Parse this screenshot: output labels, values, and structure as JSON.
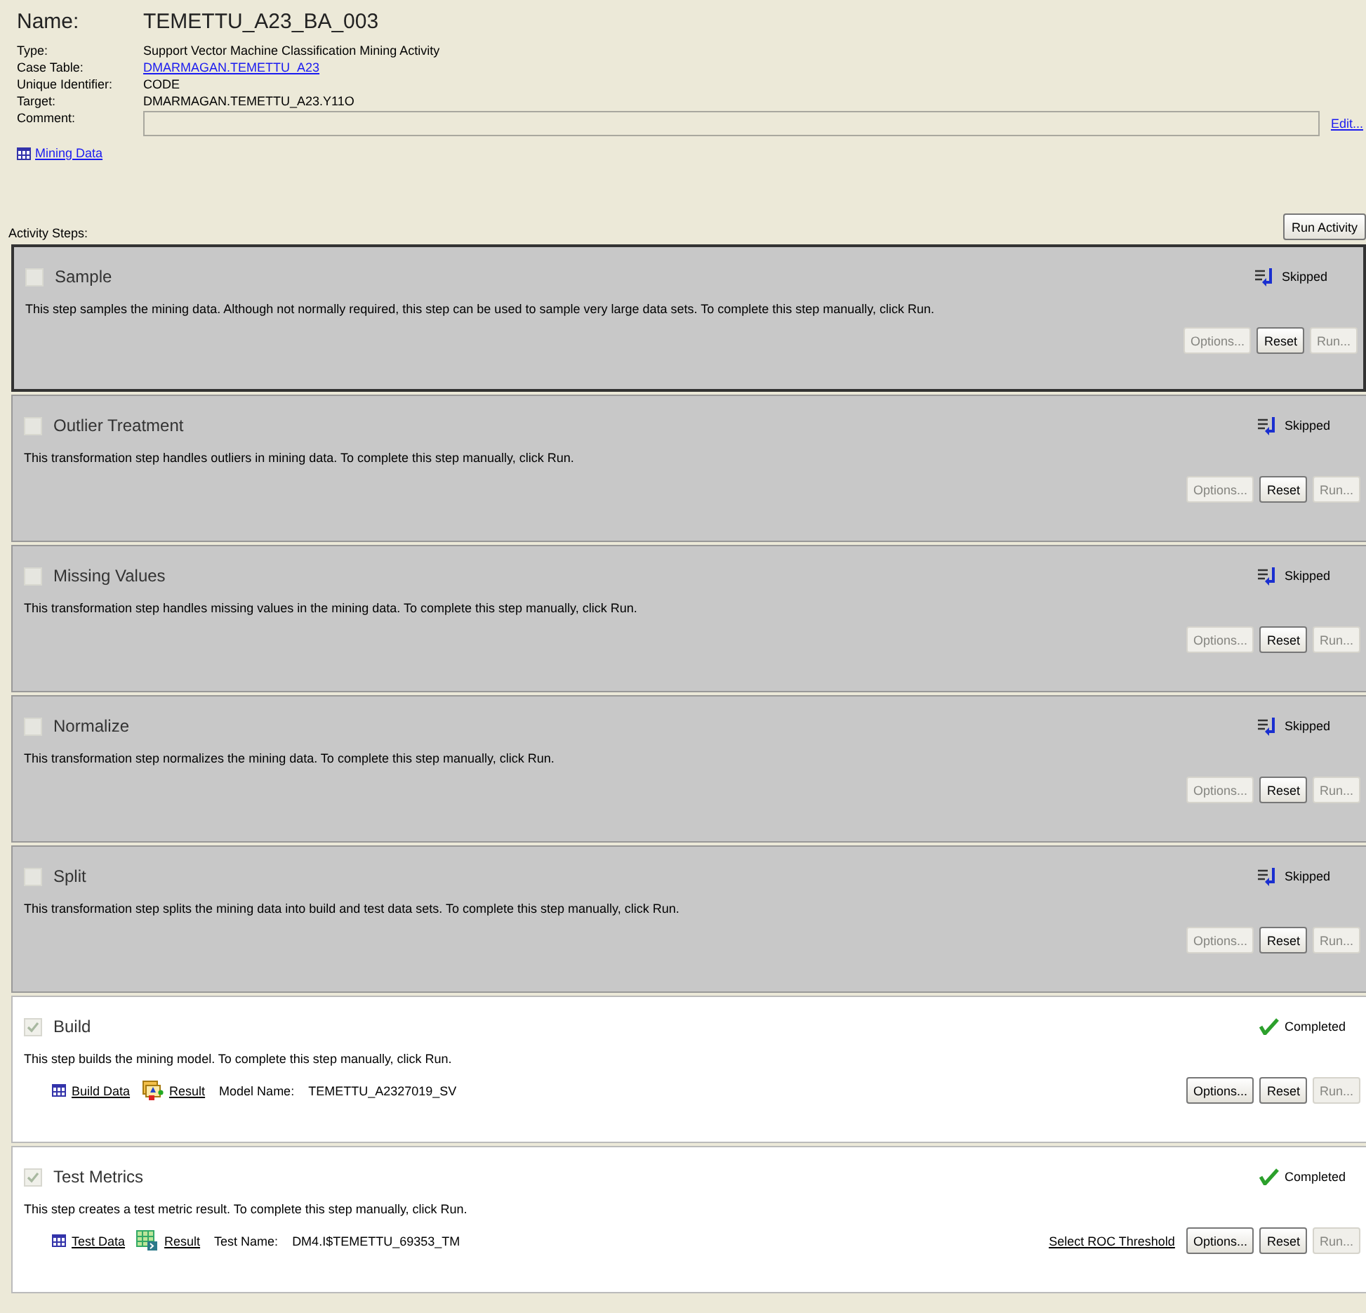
{
  "header": {
    "name_label": "Name:",
    "name": "TEMETTU_A23_BA_003",
    "fields": [
      {
        "label": "Type:",
        "value": "Support Vector Machine Classification Mining Activity",
        "kind": "text"
      },
      {
        "label": "Case Table:",
        "value": "DMARMAGAN.TEMETTU_A23",
        "kind": "link"
      },
      {
        "label": "Unique Identifier:",
        "value": "CODE",
        "kind": "text"
      },
      {
        "label": "Target:",
        "value": "DMARMAGAN.TEMETTU_A23.Y11O",
        "kind": "text"
      }
    ],
    "comment_label": "Comment:",
    "edit_link": "Edit...",
    "mining_data_link": "Mining Data"
  },
  "activity_steps_label": "Activity Steps:",
  "run_activity_button": "Run Activity",
  "steps": [
    {
      "title": "Sample",
      "selected": true,
      "checked": false,
      "status": {
        "kind": "skipped",
        "label": "Skipped"
      },
      "description": "This step samples the mining data. Although not normally required, this step can be used to sample very large data sets. To complete this step manually, click Run.",
      "buttons": [
        {
          "label": "Options...",
          "disabled": true
        },
        {
          "label": "Reset",
          "disabled": false
        },
        {
          "label": "Run...",
          "disabled": true
        }
      ]
    },
    {
      "title": "Outlier Treatment",
      "selected": false,
      "checked": false,
      "status": {
        "kind": "skipped",
        "label": "Skipped"
      },
      "description": "This transformation step handles outliers in mining data. To complete this step manually, click Run.",
      "buttons": [
        {
          "label": "Options...",
          "disabled": true
        },
        {
          "label": "Reset",
          "disabled": false
        },
        {
          "label": "Run...",
          "disabled": true
        }
      ]
    },
    {
      "title": "Missing Values",
      "selected": false,
      "checked": false,
      "status": {
        "kind": "skipped",
        "label": "Skipped"
      },
      "description": "This transformation step handles missing values in the mining data. To complete this step manually, click Run.",
      "buttons": [
        {
          "label": "Options...",
          "disabled": true
        },
        {
          "label": "Reset",
          "disabled": false
        },
        {
          "label": "Run...",
          "disabled": true
        }
      ]
    },
    {
      "title": "Normalize",
      "selected": false,
      "checked": false,
      "status": {
        "kind": "skipped",
        "label": "Skipped"
      },
      "description": "This transformation step normalizes the mining data. To complete this step manually, click Run.",
      "buttons": [
        {
          "label": "Options...",
          "disabled": true
        },
        {
          "label": "Reset",
          "disabled": false
        },
        {
          "label": "Run...",
          "disabled": true
        }
      ]
    },
    {
      "title": "Split",
      "selected": false,
      "checked": false,
      "status": {
        "kind": "skipped",
        "label": "Skipped"
      },
      "description": "This transformation step splits the mining data into build and test data sets. To complete this step manually, click Run.",
      "buttons": [
        {
          "label": "Options...",
          "disabled": true
        },
        {
          "label": "Reset",
          "disabled": false
        },
        {
          "label": "Run...",
          "disabled": true
        }
      ]
    },
    {
      "title": "Build",
      "selected": false,
      "checked": true,
      "status": {
        "kind": "completed",
        "label": "Completed"
      },
      "description": "This step builds the mining model. To complete this step manually, click Run.",
      "links": [
        {
          "kind": "table",
          "label": "Build Data"
        },
        {
          "kind": "model",
          "label": "Result"
        }
      ],
      "name_label": "Model Name:",
      "name_value": "TEMETTU_A2327019_SV",
      "buttons": [
        {
          "label": "Options...",
          "disabled": false
        },
        {
          "label": "Reset",
          "disabled": false
        },
        {
          "label": "Run...",
          "disabled": true
        }
      ]
    },
    {
      "title": "Test Metrics",
      "selected": false,
      "checked": true,
      "status": {
        "kind": "completed",
        "label": "Completed"
      },
      "description": "This step creates a test metric result. To complete this step manually, click Run.",
      "links": [
        {
          "kind": "table",
          "label": "Test Data"
        },
        {
          "kind": "grid",
          "label": "Result"
        }
      ],
      "name_label": "Test Name:",
      "name_value": "DM4.I$TEMETTU_69353_TM",
      "extra_link": "Select ROC Threshold",
      "buttons": [
        {
          "label": "Options...",
          "disabled": false
        },
        {
          "label": "Reset",
          "disabled": false
        },
        {
          "label": "Run...",
          "disabled": true
        }
      ]
    }
  ]
}
